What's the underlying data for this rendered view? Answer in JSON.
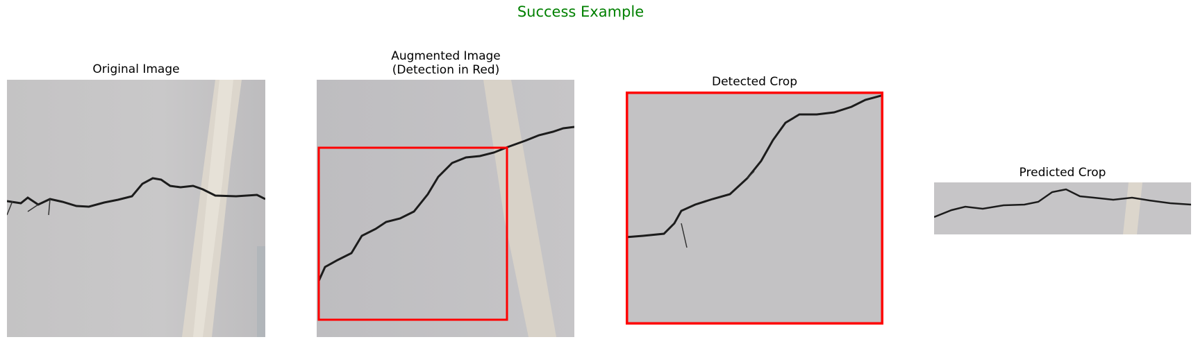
{
  "figure": {
    "suptitle": "Success Example",
    "suptitle_color": "#008000",
    "detection_color": "#ff0000"
  },
  "panels": [
    {
      "title": "Original Image",
      "content": "concrete-wall-photo-with-crack"
    },
    {
      "title": "Augmented Image\n(Detection in Red)",
      "content": "augmented-photo-with-red-detection-box"
    },
    {
      "title": "Detected Crop",
      "content": "cropped-crack-region-with-red-border"
    },
    {
      "title": "Predicted Crop",
      "content": "wide-strip-crop-of-crack"
    }
  ]
}
